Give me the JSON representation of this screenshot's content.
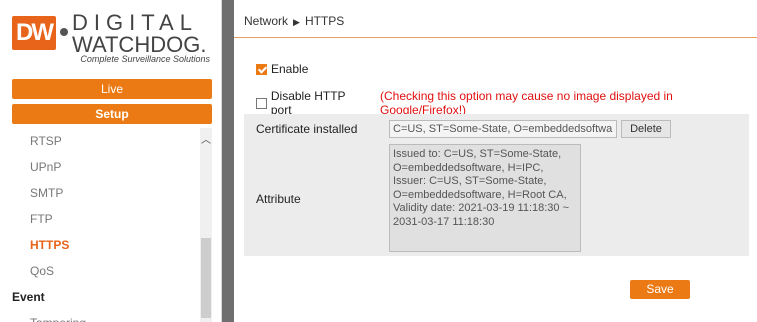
{
  "logo": {
    "dw": "DW",
    "line1": "DIGITAL",
    "line2": "WATCHDOG.",
    "tagline": "Complete Surveillance Solutions"
  },
  "nav": {
    "live": "Live",
    "setup": "Setup"
  },
  "menu": {
    "items": [
      "RTSP",
      "UPnP",
      "SMTP",
      "FTP",
      "HTTPS",
      "QoS"
    ],
    "active": "HTTPS",
    "group": "Event",
    "group_items": [
      "Tampering"
    ]
  },
  "breadcrumb": {
    "parent": "Network",
    "separator": "▶",
    "current": "HTTPS"
  },
  "form": {
    "enable_label": "Enable",
    "enable_checked": true,
    "disable_http_label": "Disable HTTP port",
    "disable_http_checked": false,
    "warning": "(Checking this option may cause no image displayed in Google/Firefox!)",
    "cert_label": "Certificate installed",
    "cert_value": "C=US, ST=Some-State, O=embeddedsoftwa",
    "delete_label": "Delete",
    "attr_label": "Attribute",
    "attr_value": "Issued to: C=US, ST=Some-State, O=embeddedsoftware, H=IPC, Issuer: C=US, ST=Some-State, O=embeddedsoftware, H=Root CA, Validity date: 2021-03-19 11:18:30 ~ 2031-03-17 11:18:30",
    "save_label": "Save"
  },
  "colors": {
    "accent": "#ec7a14",
    "warning": "#e01010",
    "divider": "#6f6f6f"
  }
}
